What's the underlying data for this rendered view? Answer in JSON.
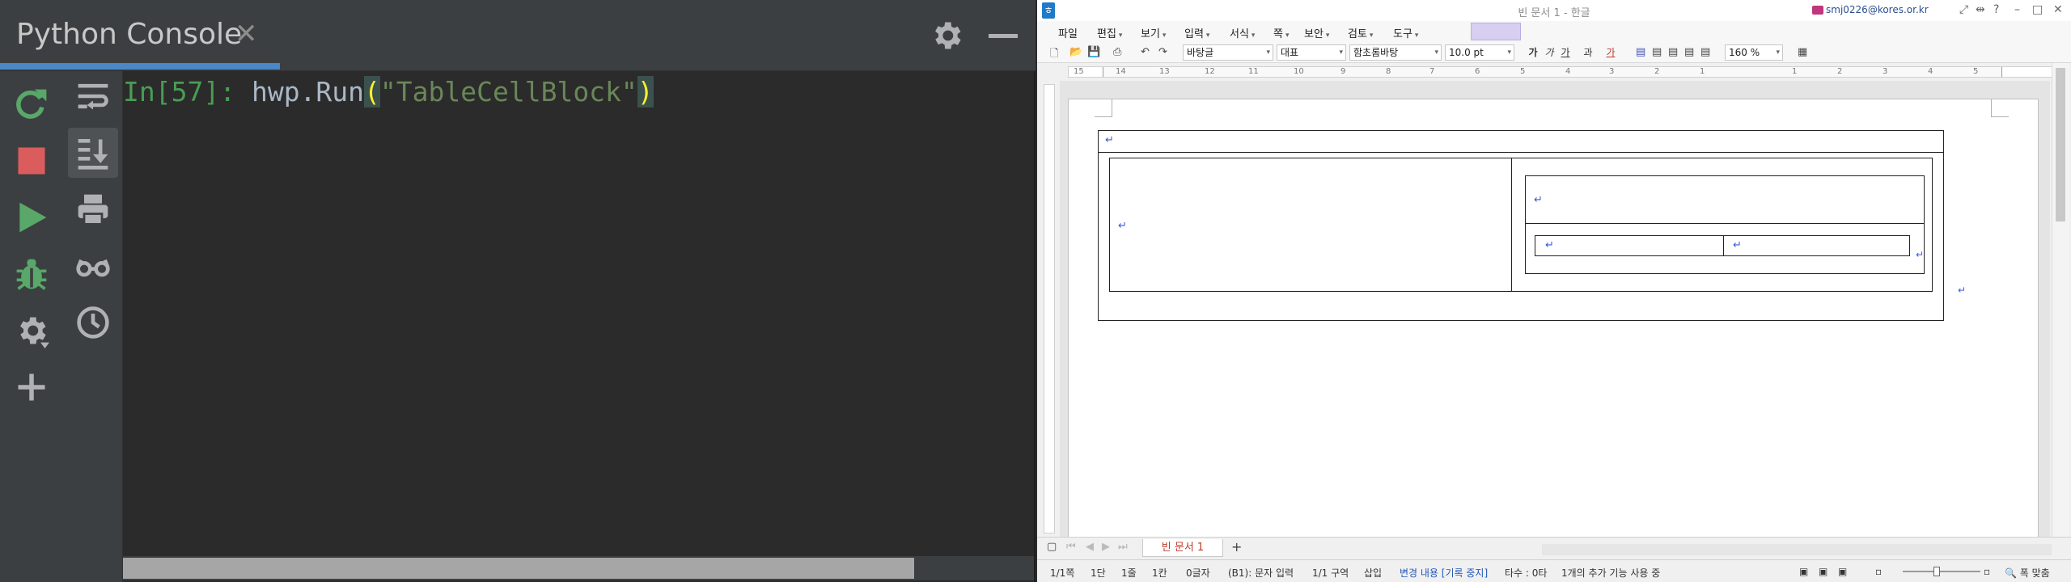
{
  "console": {
    "tab_title": "Python Console",
    "close_glyph": "✕",
    "prompt": "In[57]:",
    "code_fn": "hwp.Run",
    "code_open": "(",
    "code_arg": "\"TableCellBlock\"",
    "code_close": ")",
    "colors": {
      "accent": "#4a88c7",
      "prompt": "#499c54",
      "code": "#a9b7c6",
      "string": "#6a8759",
      "paren": "#ffef28"
    },
    "left_toolbar_icons": [
      "rerun-icon",
      "stop-icon",
      "run-icon",
      "debug-icon",
      "settings-icon",
      "add-icon"
    ],
    "right_toolbar_icons": [
      "soft-wrap-icon",
      "scroll-to-end-icon",
      "print-icon",
      "variables-glasses-icon",
      "history-icon"
    ]
  },
  "hwp": {
    "title": "빈 문서 1 - 한글",
    "user": "smj0226@kores.or.kr",
    "menu": [
      "파일",
      "편집",
      "보기",
      "입력",
      "서식",
      "쪽",
      "보안",
      "검토",
      "도구"
    ],
    "toolbar": {
      "style_font_face": "바탕글",
      "style_type": "대표",
      "font": "함초롬바탕",
      "font_size": "10.0",
      "font_unit": "pt",
      "bold": "가",
      "italic": "가",
      "underline": "가",
      "strike": "과",
      "color": "가",
      "zoom": "160",
      "zoom_unit": "%"
    },
    "ruler_numbers": [
      "15",
      "14",
      "13",
      "12",
      "11",
      "10",
      "9",
      "8",
      "7",
      "6",
      "5",
      "4",
      "3",
      "2",
      "1",
      "1",
      "2",
      "3",
      "4",
      "5"
    ],
    "para_mark": "↵",
    "doc_tab": "빈 문서 1",
    "status": {
      "page": "1/1쪽",
      "column": "1단",
      "line": "1줄",
      "char": "1칸",
      "count": "0글자",
      "cell": "(B1): 문자 입력",
      "section": "1/1 구역",
      "insert": "삽입",
      "track": "변경 내용 [기록 중지]",
      "typing": "타수 : 0타",
      "features": "1개의 추가 기능 사용 중",
      "fit": "폭 맞춤"
    }
  }
}
